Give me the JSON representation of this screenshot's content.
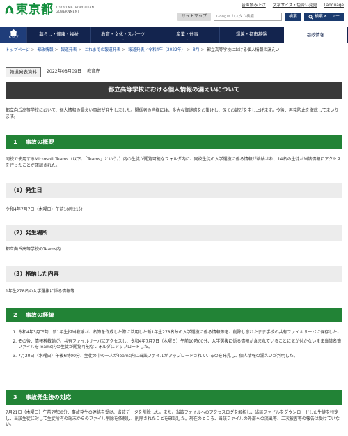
{
  "header": {
    "logo_jp": "東京都",
    "logo_en_1": "TOKYO METROPOLITAN",
    "logo_en_2": "GOVERNMENT",
    "top_links": [
      "音声読み上げ",
      "文字サイズ・色合い変更",
      "Language"
    ],
    "sitemap_label": "サイトマップ",
    "search_placeholder": "Google カスタム検索",
    "search_label": "検索",
    "advanced_search_label": "検索メニュー",
    "brand_color": "#148f3e"
  },
  "nav": {
    "home_label": "トップ",
    "items": [
      "暮らし・健康・福祉",
      "教育・文化・スポーツ",
      "産業・仕事",
      "環境・都市基盤",
      "都政情報"
    ],
    "active_index": 4
  },
  "breadcrumb": [
    "トップページ",
    "都政情報",
    "報道発表",
    "これまでの報道発表",
    "報道発表／令和4年（2022年）",
    "8月",
    "都立高等学校における個人情報の漏えい"
  ],
  "meta": {
    "badge": "報道発表資料",
    "date": "2022年08月09日",
    "department": "教育庁"
  },
  "article": {
    "title": "都立高等学校における個人情報の漏えいについて",
    "intro": "都立向丘高等学校において、個人情報の漏えい事故が発生しました。関係者の皆様には、多大な御迷惑をお掛けし、深くお詫びを申し上げます。今後、再発防止を徹底してまいります。",
    "sec1_num": "1",
    "sec1_title": "事故の概要",
    "sec1_body": "同校で使用するMicrosoft Teams（以下、「Teams」という。）内の生徒が閲覧可能なフォルダ内に、同校生徒の入学選抜に係る情報が格納され、14名の生徒が当該情報にアクセスを行ったことが確認された。",
    "sub1_title": "（1）発生日",
    "sub1_body": "令和4年7月7日（木曜日）午前10時21分",
    "sub2_title": "（2）発生場所",
    "sub2_body": "都立向丘高等学校のTeams内",
    "sub3_title": "（3）格納した内容",
    "sub3_body": "1年生278名の入学選抜に係る情報等",
    "sec2_num": "2",
    "sec2_title": "事故の経緯",
    "sec2_items": [
      "令和4年3月下旬、新1年生担当教諭が、名簿を作成した際に活用した新1年生278名分の入学選抜に係る情報等を、削除し忘れたまま学校の共有ファイルサーバに保存した。",
      "その後、情報科教諭が、共有ファイルサーバにアクセスし、令和4年7月7日（木曜日）午前10時00分、入学選抜に係る情報が含まれていることに気が付かないまま当該名簿ファイルをTeams内の生徒が閲覧可能なフォルダにアップロードした。",
      "7月20日（水曜日）午後6時00分、生徒の中の一人がTeams内に当該ファイルがアップロードされているのを発見し、個人情報の漏えいが判明した。"
    ],
    "sec3_num": "3",
    "sec3_title": "事故発生後の対応",
    "sec3_body": "7月21日（木曜日）午前7時30分、事故発生の連絡を受け、当該データを削除した。また、当該ファイルへのアクセスログを解析し、当該ファイルをダウンロードした生徒を特定し、当該生徒に対して生徒所有の端末からのファイル削除を依頼し、削除されたことを確認した。現在のところ、当該ファイルの外部への流出等、二次被害等の報告は受けていない。"
  }
}
